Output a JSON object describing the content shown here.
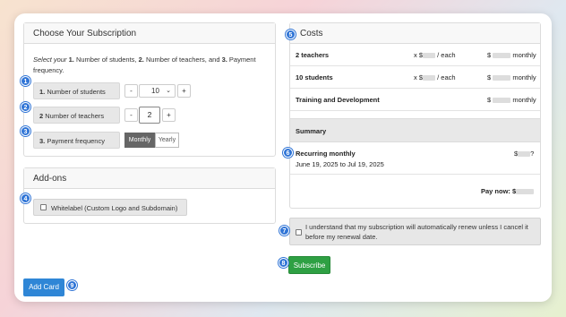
{
  "subscription": {
    "title": "Choose Your Subscription",
    "instructions": {
      "prefix": "Select your",
      "n1": "1.",
      "t1": " Number of students, ",
      "n2": "2.",
      "t2": " Number of teachers, and ",
      "n3": "3.",
      "t3": " Payment frequency."
    },
    "students": {
      "num": "1.",
      "label": " Number of students",
      "value": "10",
      "minus": "-",
      "plus": "+"
    },
    "teachers": {
      "num": "2",
      "label": " Number of teachers",
      "value": "2",
      "minus": "-",
      "plus": "+"
    },
    "frequency": {
      "num": "3.",
      "label": " Payment frequency",
      "options": [
        "Monthly",
        "Yearly"
      ],
      "selected": "Monthly"
    }
  },
  "addons": {
    "title": "Add-ons",
    "whitelabel_label": "Whitelabel (Custom Logo and Subdomain)"
  },
  "costs": {
    "title": "Costs",
    "rows": [
      {
        "name": "2 teachers",
        "mult_prefix": "x $",
        "mult_suffix": "/ each",
        "amt_prefix": "$",
        "amt_suffix": "monthly"
      },
      {
        "name": "10 students",
        "mult_prefix": "x $",
        "mult_suffix": "/ each",
        "amt_prefix": "$",
        "amt_suffix": "monthly"
      },
      {
        "name": "Training and Development",
        "amt_prefix": "$",
        "amt_suffix": "monthly"
      }
    ],
    "summary_title": "Summary",
    "recurring_label": "Recurring monthly",
    "recurring_amount_prefix": "$",
    "recurring_amount_suffix": "?",
    "date_range": "June 19, 2025 to Jul 19, 2025",
    "pay_now_label": "Pay now: $"
  },
  "agreement": {
    "text": "I understand that my subscription will automatically renew unless I cancel it before my renewal date."
  },
  "buttons": {
    "subscribe": "Subscribe",
    "add_card": "Add Card"
  },
  "badges": [
    "1",
    "2",
    "3",
    "4",
    "5",
    "6",
    "7",
    "8",
    "9"
  ],
  "colors": {
    "accent": "#2f74d6",
    "subscribe": "#2ea043",
    "add_card": "#2f86d6",
    "segment_active": "#666666"
  }
}
